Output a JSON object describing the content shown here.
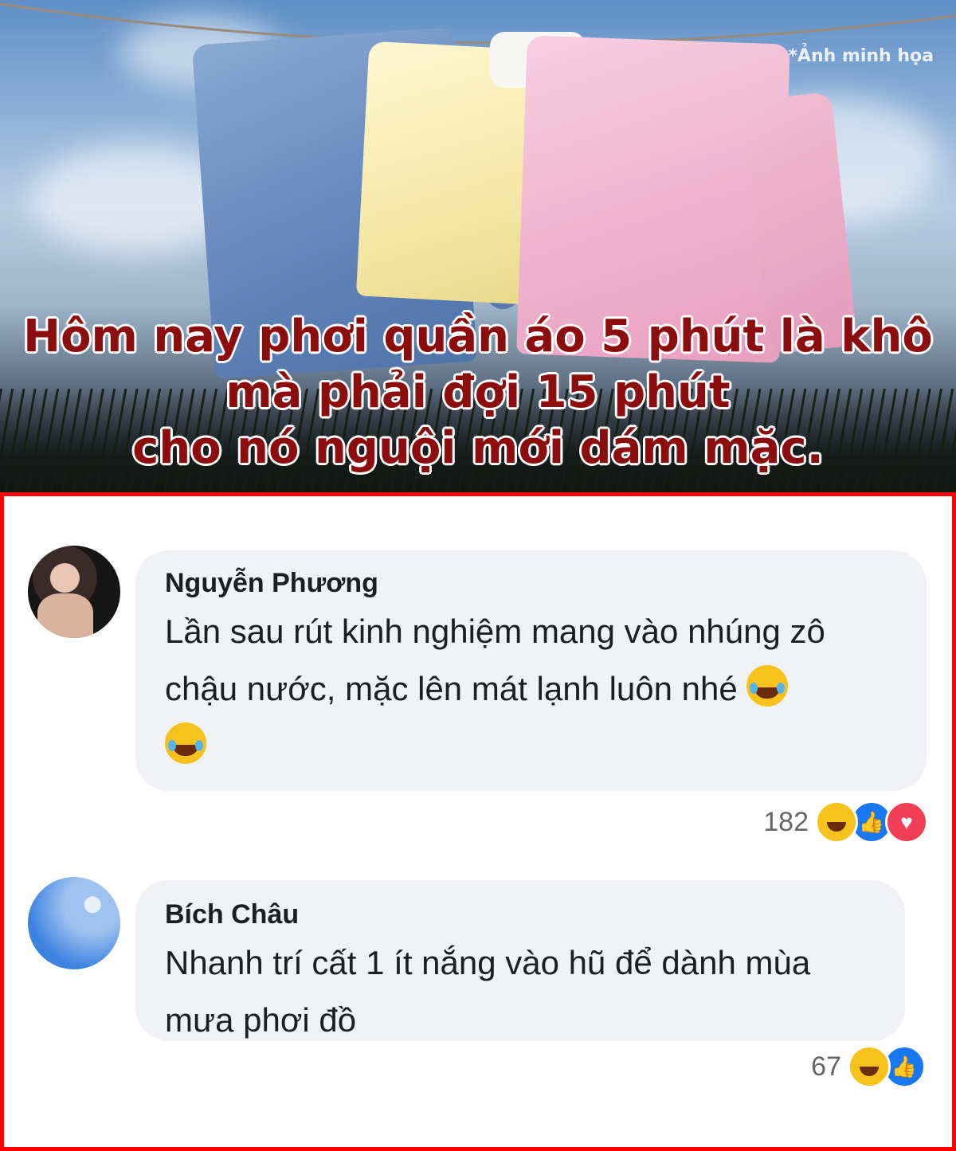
{
  "banner": {
    "caption": "*Ảnh minh họa",
    "headline_lines": [
      "Hôm nay phơi quần áo 5 phút là khô",
      "mà phải đợi 15 phút",
      "cho nó nguội mới dám mặc."
    ],
    "headline_color": "#8b0d0d"
  },
  "comments": [
    {
      "author": "Nguyễn Phương",
      "text_lines": [
        "Lần sau rút kinh nghiệm mang vào nhúng zô",
        "chậu nước, mặc lên mát lạnh luôn nhé"
      ],
      "reaction_count": "182",
      "reaction_icons": [
        "haha-icon",
        "like-icon",
        "love-icon"
      ]
    },
    {
      "author": "Bích Châu",
      "text_lines": [
        "Nhanh trí cất 1 ít nắng vào hũ để dành mùa",
        "mưa phơi đồ"
      ],
      "reaction_count": "67",
      "reaction_icons": [
        "haha-icon",
        "like-icon"
      ]
    }
  ],
  "colors": {
    "panel_border": "#ff0000",
    "bubble_bg": "#f0f2f5",
    "like": "#1877f2",
    "love": "#f33e58"
  }
}
